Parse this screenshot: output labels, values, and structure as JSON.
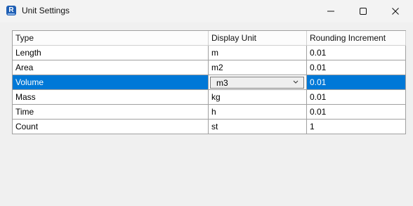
{
  "window": {
    "title": "Unit Settings",
    "app_icon_letter": "R"
  },
  "grid": {
    "headers": [
      "Type",
      "Display Unit",
      "Rounding Increment"
    ],
    "rows": [
      {
        "type": "Length",
        "unit": "m",
        "rounding": "0.01"
      },
      {
        "type": "Area",
        "unit": "m2",
        "rounding": "0.01"
      },
      {
        "type": "Volume",
        "unit": "m3",
        "rounding": "0.01"
      },
      {
        "type": "Mass",
        "unit": "kg",
        "rounding": "0.01"
      },
      {
        "type": "Time",
        "unit": "h",
        "rounding": "0.01"
      },
      {
        "type": "Count",
        "unit": "st",
        "rounding": "1"
      }
    ],
    "selected_row": "Volume"
  },
  "colors": {
    "selection": "#0078d7",
    "app_icon": "#1f5fb4"
  }
}
